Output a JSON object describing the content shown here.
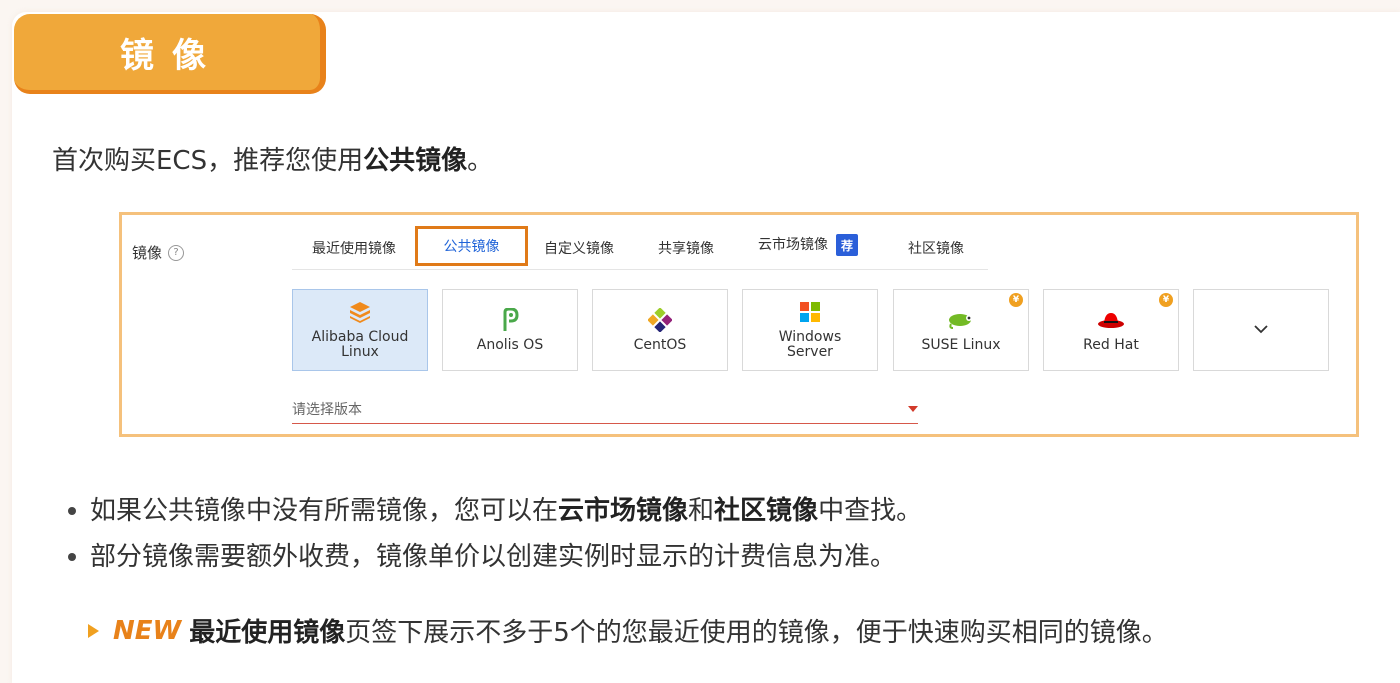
{
  "section": {
    "title": "镜像"
  },
  "intro": {
    "prefix": "首次购买ECS，推荐您使用",
    "bold": "公共镜像",
    "suffix": "。"
  },
  "console": {
    "label": "镜像",
    "help_symbol": "?",
    "tabs": [
      {
        "label": "最近使用镜像"
      },
      {
        "label": "公共镜像",
        "active": true
      },
      {
        "label": "自定义镜像"
      },
      {
        "label": "共享镜像"
      },
      {
        "label": "云市场镜像",
        "badge": "荐"
      },
      {
        "label": "社区镜像"
      }
    ],
    "os_options": [
      {
        "name": "Alibaba Cloud Linux",
        "selected": true
      },
      {
        "name": "Anolis OS"
      },
      {
        "name": "CentOS"
      },
      {
        "name": "Windows Server"
      },
      {
        "name": "SUSE Linux",
        "paid_badge": "¥"
      },
      {
        "name": "Red Hat",
        "paid_badge": "¥"
      }
    ],
    "version_placeholder": "请选择版本"
  },
  "bullets": {
    "b1": {
      "p1": "如果公共镜像中没有所需镜像，您可以在",
      "bold1": "云市场镜像",
      "p2": "和",
      "bold2": "社区镜像",
      "p3": "中查找。"
    },
    "b2": {
      "text": "部分镜像需要额外收费，镜像单价以创建实例时显示的计费信息为准。"
    }
  },
  "note": {
    "new_label": "NEW",
    "bold": "最近使用镜像",
    "text": "页签下展示不多于5个的您最近使用的镜像，便于快速购买相同的镜像。"
  },
  "colors": {
    "accent_orange": "#f0a83a",
    "active_tab_border": "#e07a18",
    "link_blue": "#1f63d8",
    "recommend_blue": "#2b5fd9"
  }
}
